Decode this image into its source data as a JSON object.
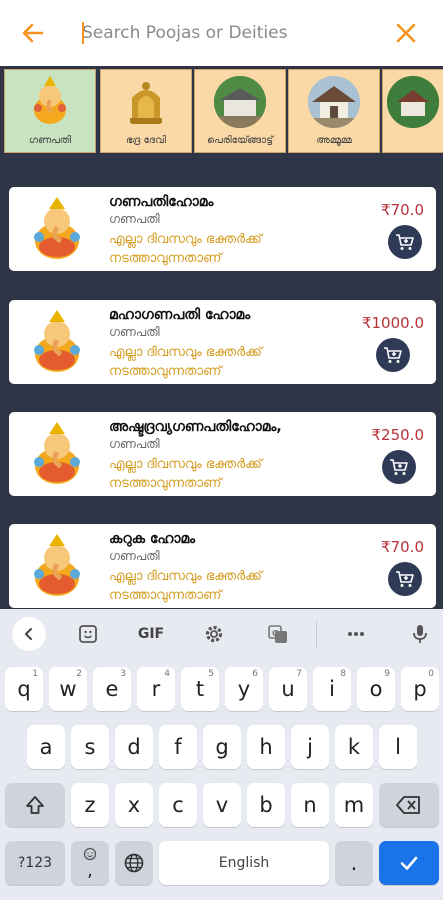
{
  "search": {
    "placeholder": "Search Poojas or Deities"
  },
  "deities": [
    {
      "label": "ഗണപതി",
      "selected": true
    },
    {
      "label": "ഭദ്ര ദേവി",
      "selected": false
    },
    {
      "label": "പെരിയ്ങ്ങോട്ട്",
      "selected": false
    },
    {
      "label": "അമ്മൂമ്മ",
      "selected": false
    },
    {
      "label": "",
      "selected": false
    }
  ],
  "poojas": [
    {
      "title": "ഗണപതിഹോമം",
      "deity": "ഗണപതി",
      "desc": "എല്ലാ ദിവസവും ഭക്തർക്ക് നടത്താവുന്നതാണ്",
      "price": "₹70.0"
    },
    {
      "title": "മഹാഗണപതി ഹോമം",
      "deity": "ഗണപതി",
      "desc": "എല്ലാ ദിവസവും ഭക്തർക്ക് നടത്താവുന്നതാണ്",
      "price": "₹1000.0"
    },
    {
      "title": "അഷ്ടദ്രവ്യഗണപതിഹോമം,",
      "deity": "ഗണപതി",
      "desc": "എല്ലാ ദിവസവും ഭക്തർക്ക് നടത്താവുന്നതാണ്",
      "price": "₹250.0"
    },
    {
      "title": "കറുക ഹോമം",
      "deity": "ഗണപതി",
      "desc": "എല്ലാ ദിവസവും ഭക്തർക്ക് നടത്താവുന്നതാണ്",
      "price": "₹70.0"
    }
  ],
  "keyboard": {
    "toolbar": {
      "gif": "GIF"
    },
    "row1": [
      {
        "k": "q",
        "h": "1"
      },
      {
        "k": "w",
        "h": "2"
      },
      {
        "k": "e",
        "h": "3"
      },
      {
        "k": "r",
        "h": "4"
      },
      {
        "k": "t",
        "h": "5"
      },
      {
        "k": "y",
        "h": "6"
      },
      {
        "k": "u",
        "h": "7"
      },
      {
        "k": "i",
        "h": "8"
      },
      {
        "k": "o",
        "h": "9"
      },
      {
        "k": "p",
        "h": "0"
      }
    ],
    "row2": [
      "a",
      "s",
      "d",
      "f",
      "g",
      "h",
      "j",
      "k",
      "l"
    ],
    "row3": [
      "z",
      "x",
      "c",
      "v",
      "b",
      "n",
      "m"
    ],
    "symbols_label": "?123",
    "comma_label": ",",
    "space_label": "English",
    "period_label": "."
  },
  "colors": {
    "accent": "#f7931e",
    "dark_bg": "#2f3546",
    "price": "#b8323a",
    "desc": "#d49a1a",
    "cart": "#2f3a57",
    "enter": "#1a73e8"
  }
}
